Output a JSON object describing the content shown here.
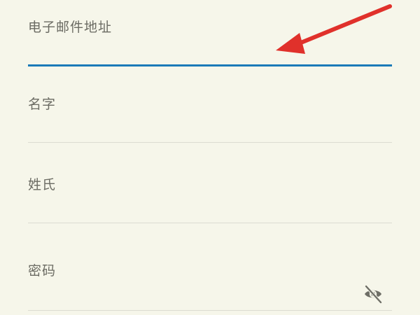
{
  "form": {
    "email": {
      "label": "电子邮件地址",
      "value": ""
    },
    "first_name": {
      "label": "名字",
      "value": ""
    },
    "last_name": {
      "label": "姓氏",
      "value": ""
    },
    "password": {
      "label": "密码",
      "value": ""
    }
  },
  "icons": {
    "password_toggle": "eye-off-icon",
    "annotation": "red-arrow"
  },
  "colors": {
    "background": "#f6f6ea",
    "active_underline": "#1b7ab8",
    "inactive_underline": "#dcdcd2",
    "label": "#6b6b63",
    "annotation_arrow": "#e0312b",
    "icon": "#6e6e66"
  }
}
